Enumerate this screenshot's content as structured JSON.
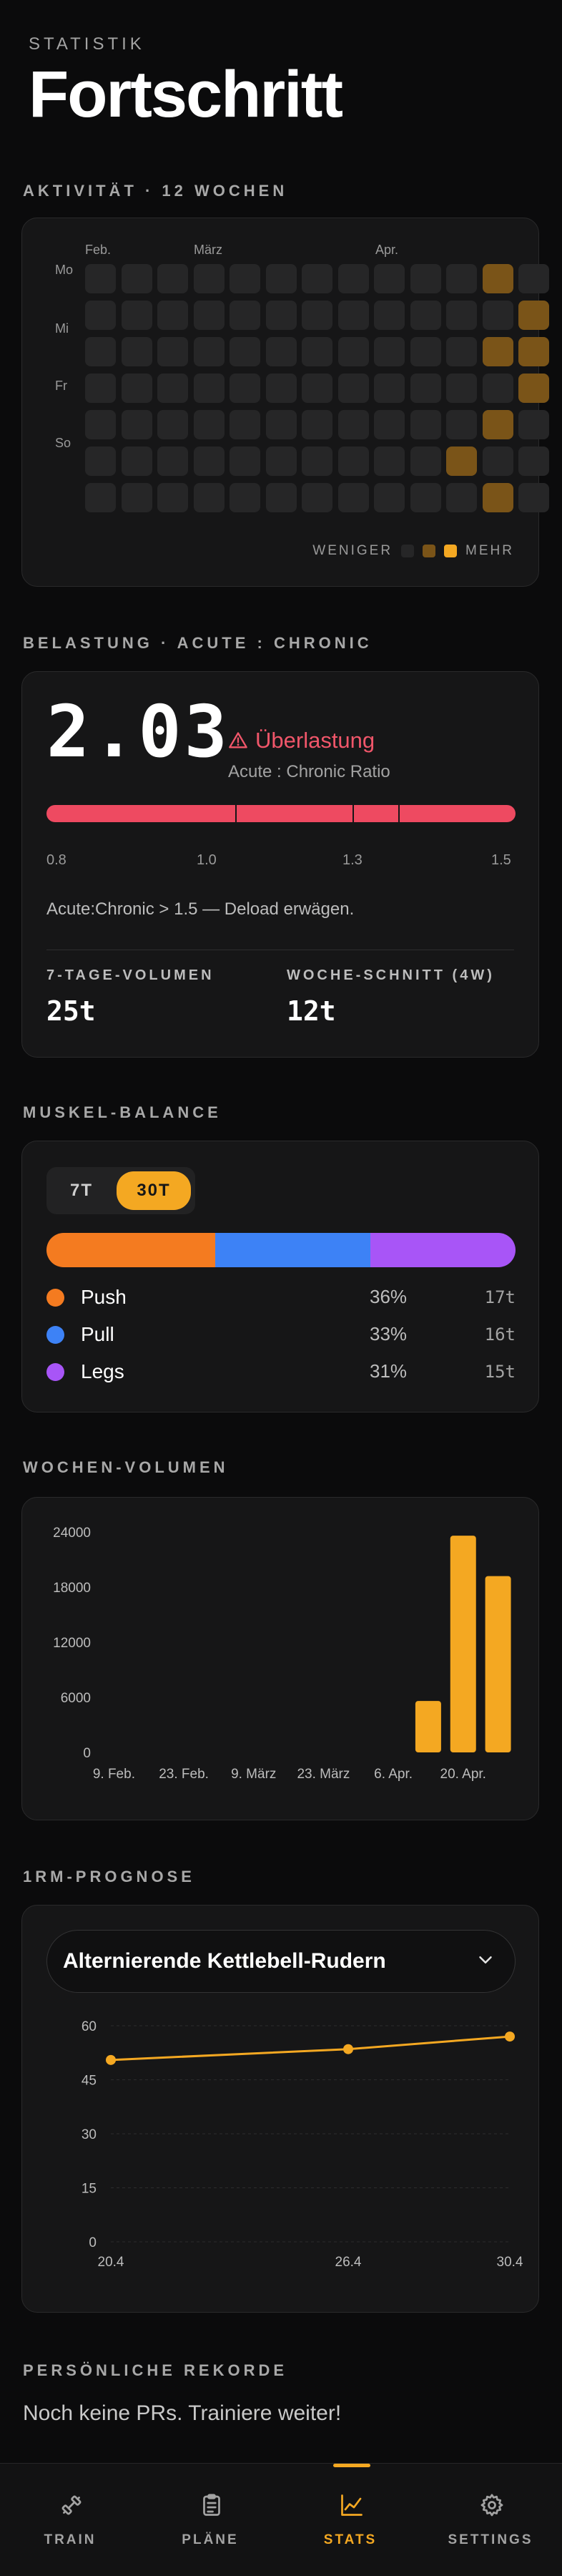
{
  "header": {
    "eyebrow": "STATISTIK",
    "title": "Fortschritt"
  },
  "activity": {
    "label": "AKTIVITÄT · 12 WOCHEN",
    "months": [
      "Feb.",
      "März",
      "Apr."
    ],
    "days": [
      "Mo",
      "Mi",
      "Fr",
      "So"
    ],
    "active_cells": [
      [
        0,
        11
      ],
      [
        1,
        12
      ],
      [
        2,
        11
      ],
      [
        2,
        12
      ],
      [
        3,
        12
      ],
      [
        4,
        11
      ],
      [
        5,
        10
      ],
      [
        6,
        11
      ]
    ],
    "legend_less": "WENIGER",
    "legend_more": "MEHR",
    "colors": {
      "empty": "#262627",
      "mid": "#7a5418",
      "high": "#f4a822"
    }
  },
  "load": {
    "label": "BELASTUNG · ACUTE : CHRONIC",
    "value": "2.03",
    "status": "Überlastung",
    "subtitle": "Acute : Chronic Ratio",
    "scale": [
      "0.8",
      "1.0",
      "1.3",
      "1.5"
    ],
    "note": "Acute:Chronic > 1.5 — Deload erwägen.",
    "volume_label": "7-TAGE-VOLUMEN",
    "volume_value": "25t",
    "avg_label": "WOCHE-SCHNITT (4W)",
    "avg_value": "12t",
    "color": "#ee4a61"
  },
  "balance": {
    "label": "MUSKEL-BALANCE",
    "segments": [
      {
        "label": "7T",
        "selected": false
      },
      {
        "label": "30T",
        "selected": true
      }
    ],
    "groups": [
      {
        "name": "Push",
        "pct": "36%",
        "amount": "17t",
        "value": 36,
        "color": "#f47b20"
      },
      {
        "name": "Pull",
        "pct": "33%",
        "amount": "16t",
        "value": 33,
        "color": "#3d82f6"
      },
      {
        "name": "Legs",
        "pct": "31%",
        "amount": "15t",
        "value": 31,
        "color": "#a855f7"
      }
    ]
  },
  "weekly": {
    "label": "WOCHEN-VOLUMEN",
    "chart_data": {
      "type": "bar",
      "categories": [
        "9. Feb.",
        "16. Feb.",
        "23. Feb.",
        "2. März",
        "9. März",
        "16. März",
        "23. März",
        "30. März",
        "6. Apr.",
        "13. Apr.",
        "20. Apr.",
        "27. Apr."
      ],
      "tick_labels": [
        "9. Feb.",
        "23. Feb.",
        "9. März",
        "23. März",
        "6. Apr.",
        "20. Apr."
      ],
      "values": [
        0,
        0,
        0,
        0,
        0,
        0,
        0,
        0,
        0,
        5600,
        23600,
        19200
      ],
      "yticks": [
        "0",
        "6000",
        "12000",
        "18000",
        "24000"
      ],
      "ylim": [
        0,
        24000
      ],
      "color": "#f4a822"
    }
  },
  "orm": {
    "label": "1RM-PROGNOSE",
    "exercise": "Alternierende Kettlebell-Rudern",
    "chart_data": {
      "type": "line",
      "x": [
        "20.4",
        "26.4",
        "30.4"
      ],
      "values": [
        50.5,
        53.5,
        57
      ],
      "yticks": [
        "0",
        "15",
        "30",
        "45",
        "60"
      ],
      "ylim": [
        0,
        60
      ],
      "color": "#f4a822"
    }
  },
  "records": {
    "label": "PERSÖNLICHE REKORDE",
    "empty_text": "Noch keine PRs. Trainiere weiter!"
  },
  "nav": {
    "items": [
      {
        "label": "TRAIN",
        "icon": "dumbbell-icon",
        "active": false
      },
      {
        "label": "PLÄNE",
        "icon": "clipboard-icon",
        "active": false
      },
      {
        "label": "STATS",
        "icon": "chart-icon",
        "active": true
      },
      {
        "label": "SETTINGS",
        "icon": "gear-icon",
        "active": false
      }
    ]
  }
}
